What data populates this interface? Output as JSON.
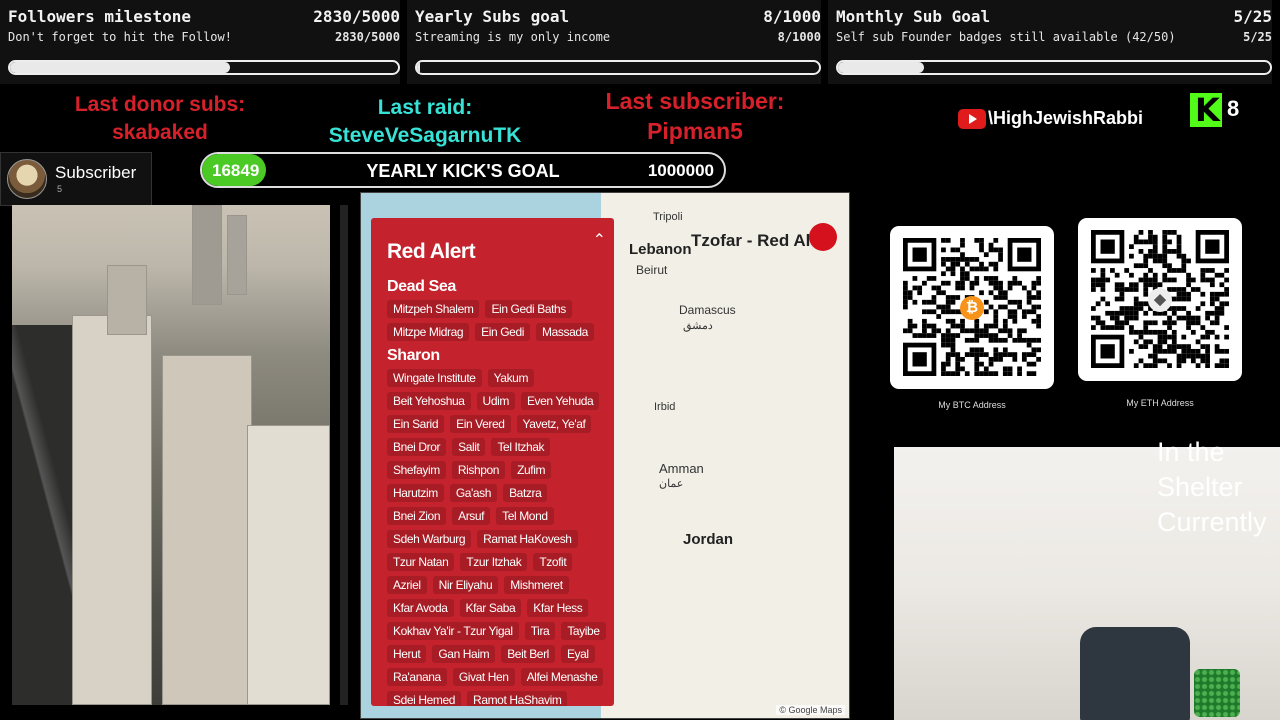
{
  "goals": [
    {
      "title": "Followers milestone",
      "subtitle": "Don't forget to hit the Follow!",
      "count": "2830/5000",
      "progress": 0.566
    },
    {
      "title": "Yearly Subs goal",
      "subtitle": "Streaming is my only income",
      "count": "8/1000",
      "progress": 0.008
    },
    {
      "title": "Monthly Sub Goal",
      "subtitle": "Self sub Founder badges still available (42/50)",
      "count": "5/25",
      "progress": 0.2
    }
  ],
  "tickers": {
    "donor_label": "Last donor subs:",
    "donor_name": "skabaked",
    "raid_label": "Last raid:",
    "raid_name": "SteveVeSagarnuTK",
    "subscriber_label": "Last subscriber:",
    "subscriber_name": "Pipman5"
  },
  "subscriber_box": {
    "label": "Subscriber",
    "count": "5"
  },
  "kick_goal": {
    "current": "16849",
    "title": "YEARLY KICK'S GOAL",
    "target": "1000000",
    "progress": 0.0168
  },
  "youtube": {
    "handle": "\\HighJewishRabbi"
  },
  "kick": {
    "viewers": "8"
  },
  "map": {
    "header": "Tzofar - Red Alert",
    "labels": {
      "lebanon": "Lebanon",
      "beirut": "Beirut",
      "damascus": "Damascus",
      "damascus_ar": "دمشق",
      "amman": "Amman",
      "amman_ar": "عمان",
      "jordan": "Jordan",
      "irbid": "Irbid",
      "tripoli": "Tripoli"
    },
    "attribution": "© Google Maps"
  },
  "red_alert": {
    "title": "Red Alert",
    "regions": [
      {
        "name": "Dead Sea",
        "places": [
          "Mitzpeh Shalem",
          "Ein Gedi Baths",
          "Mitzpe Midrag",
          "Ein Gedi",
          "Massada"
        ]
      },
      {
        "name": "Sharon",
        "places": [
          "Wingate Institute",
          "Yakum",
          "Beit Yehoshua",
          "Udim",
          "Even Yehuda",
          "Ein Sarid",
          "Ein Vered",
          "Yavetz, Ye'af",
          "Bnei Dror",
          "Salit",
          "Tel Itzhak",
          "Shefayim",
          "Rishpon",
          "Zufim",
          "Harutzim",
          "Ga'ash",
          "Batzra",
          "Bnei Zion",
          "Arsuf",
          "Tel Mond",
          "Sdeh Warburg",
          "Ramat HaKovesh",
          "Tzur Natan",
          "Tzur Itzhak",
          "Tzofit",
          "Azriel",
          "Nir Eliyahu",
          "Mishmeret",
          "Kfar Avoda",
          "Kfar Saba",
          "Kfar Hess",
          "Kokhav Ya'ir - Tzur Yigal",
          "Tira",
          "Tayibe",
          "Herut",
          "Gan Haim",
          "Beit Berl",
          "Eyal",
          "Ra'anana",
          "Givat Hen",
          "Alfei Menashe",
          "Sdei Hemed",
          "Ramot HaShavim"
        ]
      }
    ]
  },
  "qr": {
    "btc_label": "My BTC Address",
    "eth_label": "My ETH Address"
  },
  "shelter_text": [
    "In the",
    "Shelter",
    "Currently"
  ]
}
